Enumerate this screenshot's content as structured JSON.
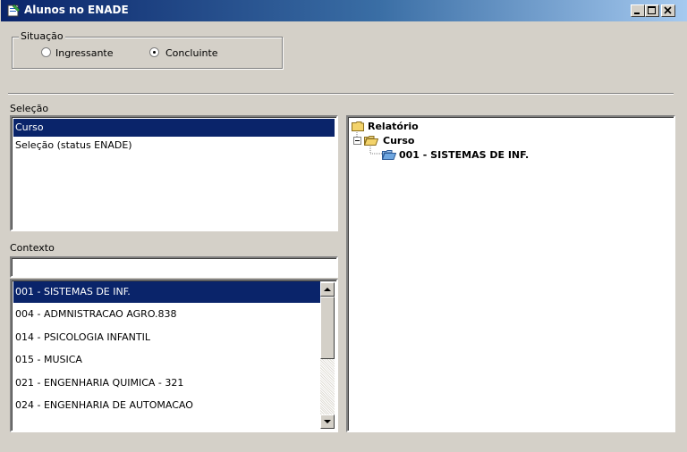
{
  "window": {
    "title": "Alunos no ENADE",
    "icon": "app-icon",
    "controls": [
      "minimize-icon",
      "maximize-icon",
      "close-icon"
    ]
  },
  "situacao": {
    "legend": "Situação",
    "options": [
      {
        "label": "Ingressante",
        "checked": false
      },
      {
        "label": "Concluinte",
        "checked": true
      }
    ]
  },
  "selecao": {
    "label": "Seleção",
    "items": [
      {
        "label": "Curso",
        "selected": true
      },
      {
        "label": "Seleção (status ENADE)",
        "selected": false
      }
    ]
  },
  "contexto": {
    "label": "Contexto",
    "filter_value": "",
    "items": [
      {
        "label": "001 - SISTEMAS DE INF.",
        "selected": true
      },
      {
        "label": "004 - ADMNISTRACAO AGRO.838",
        "selected": false
      },
      {
        "label": "014 - PSICOLOGIA INFANTIL",
        "selected": false
      },
      {
        "label": "015 - MUSICA",
        "selected": false
      },
      {
        "label": "021 - ENGENHARIA QUIMICA - 321",
        "selected": false
      },
      {
        "label": "024 - ENGENHARIA DE AUTOMACAO",
        "selected": false
      }
    ]
  },
  "tree": {
    "root": "Relatório",
    "level1": "Curso",
    "level2": "001 - SISTEMAS DE INF."
  },
  "colors": {
    "selection": "#0a246a",
    "face": "#d4d0c8",
    "folder": "#f3d36b"
  }
}
